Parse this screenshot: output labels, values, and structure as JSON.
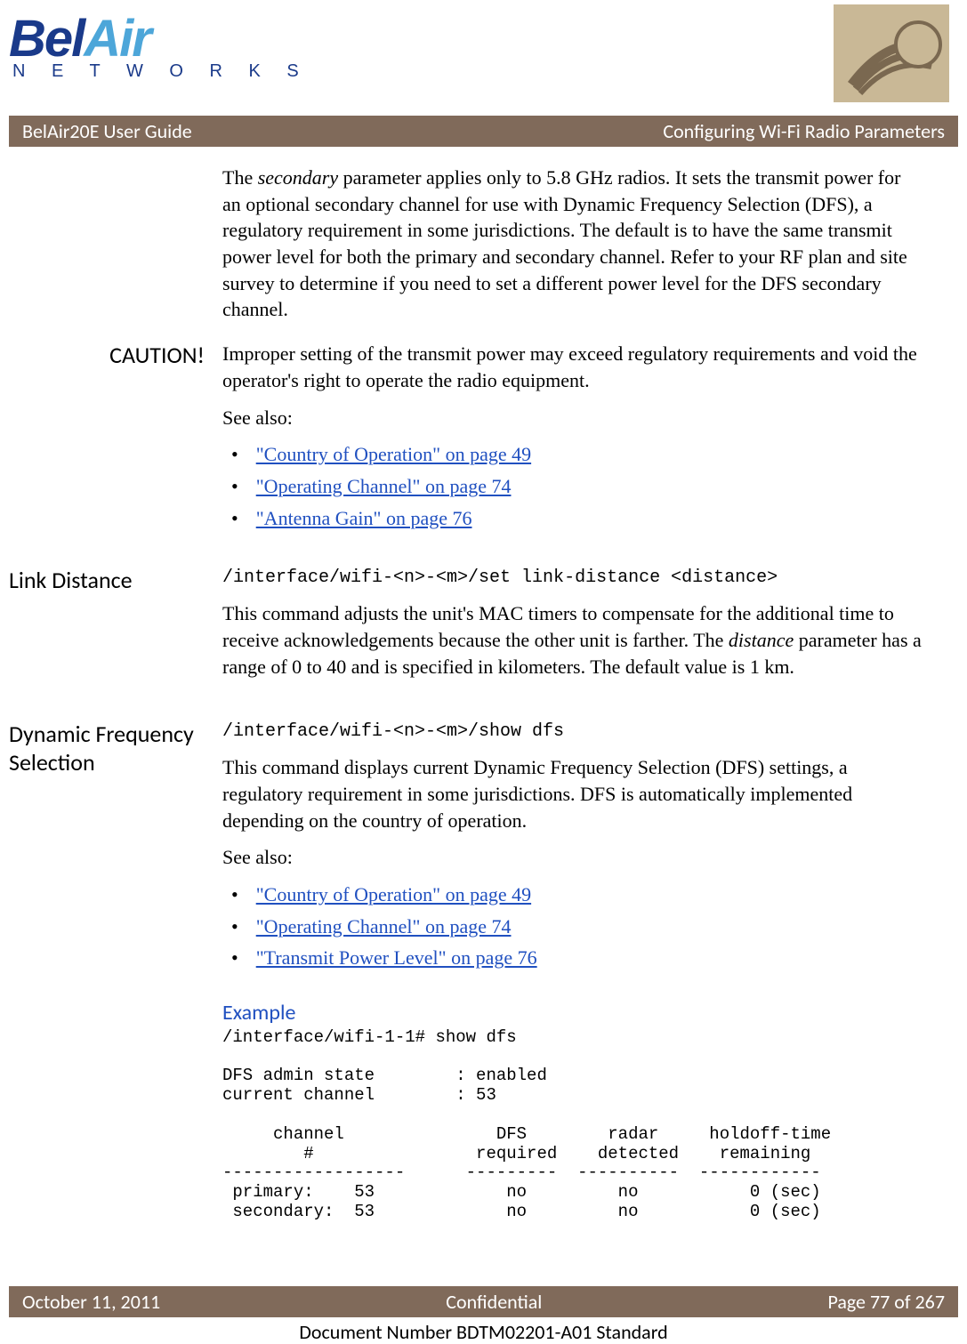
{
  "header": {
    "logo_bel": "Bel",
    "logo_air": "Air",
    "networks": "N E T W O R K S"
  },
  "titlebar": {
    "left": "BelAir20E User Guide",
    "right": "Configuring Wi-Fi Radio Parameters"
  },
  "section1": {
    "para1_prefix": "The ",
    "para1_em": "secondary",
    "para1_rest": " parameter applies only to 5.8 GHz radios. It sets the transmit power for an optional secondary channel for use with Dynamic Frequency Selection (DFS), a regulatory requirement in some jurisdictions. The default is to have the same transmit power level for both the primary and secondary channel. Refer to your RF plan and site survey to determine if you need to set a different power level for the DFS secondary channel.",
    "caution_label": "CAUTION!",
    "caution_text": "Improper setting of the transmit power may exceed regulatory requirements and void the operator's right to operate the radio equipment.",
    "see_also": "See also:",
    "links": [
      "\"Country of Operation\" on page 49",
      "\"Operating Channel\" on page 74",
      "\"Antenna Gain\" on page 76"
    ]
  },
  "section2": {
    "heading": "Link Distance",
    "cmd": "/interface/wifi-<n>-<m>/set link-distance <distance>",
    "para_prefix": "This command adjusts the unit's MAC timers to compensate for the additional time to receive acknowledgements because the other unit is farther. The ",
    "para_em": "distance",
    "para_rest": " parameter has a range of 0 to 40 and is specified in kilometers. The default value is 1 km."
  },
  "section3": {
    "heading": "Dynamic Frequency Selection",
    "cmd": "/interface/wifi-<n>-<m>/show dfs",
    "para": "This command displays current Dynamic Frequency Selection (DFS) settings, a regulatory requirement in some jurisdictions. DFS is automatically implemented depending on the country of operation.",
    "see_also": "See also:",
    "links": [
      "\"Country of Operation\" on page 49",
      "\"Operating Channel\" on page 74",
      "\"Transmit Power Level\" on page 76"
    ],
    "example_heading": "Example",
    "example_block": "/interface/wifi-1-1# show dfs\n\nDFS admin state        : enabled\ncurrent channel        : 53\n\n     channel               DFS        radar     holdoff-time\n        #                required    detected    remaining\n------------------      ---------  ----------  ------------\n primary:    53             no         no           0 (sec)\n secondary:  53             no         no           0 (sec)"
  },
  "footer": {
    "left": "October 11, 2011",
    "center": "Confidential",
    "right": "Page 77 of 267",
    "doc": "Document Number BDTM02201-A01 Standard"
  }
}
